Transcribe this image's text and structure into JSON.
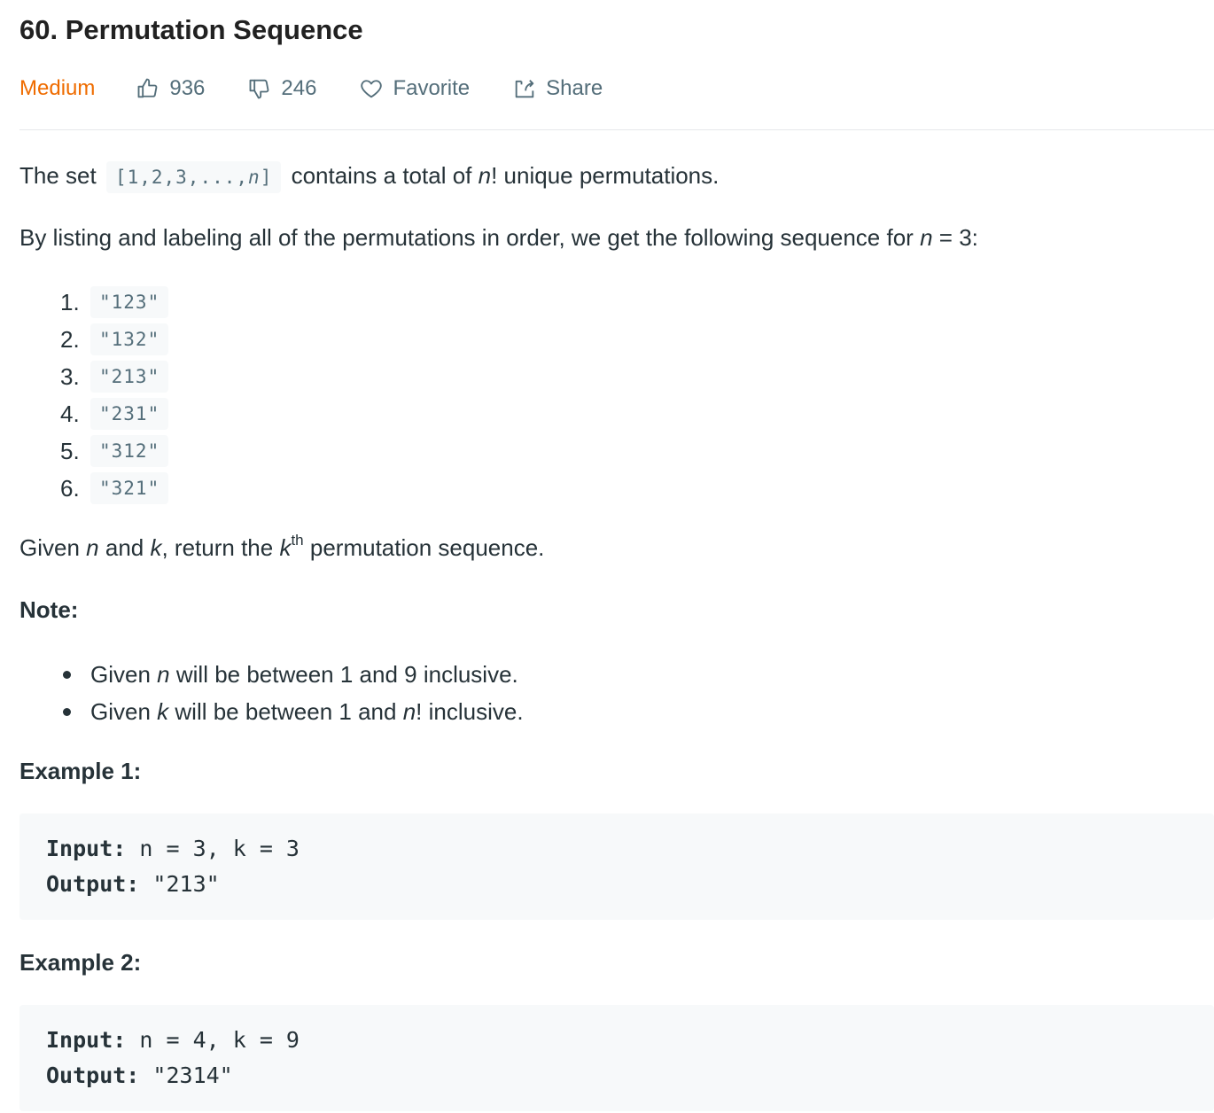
{
  "problem": {
    "title": "60. Permutation Sequence",
    "difficulty": "Medium",
    "likes": "936",
    "dislikes": "246",
    "favorite_label": "Favorite",
    "share_label": "Share"
  },
  "colors": {
    "difficulty": "#ef6c00",
    "meta_text": "#546e7a",
    "code_bg": "#f7f9fa"
  },
  "description": {
    "p1_prefix": "The set",
    "p1_code": "[1,2,3,...,",
    "p1_code_var": "n",
    "p1_code_end": "]",
    "p1_mid": "contains a total of",
    "p1_var": "n",
    "p1_suffix": "! unique permutations.",
    "p2_prefix": "By listing and labeling all of the permutations in order, we get the following sequence for",
    "p2_var": "n",
    "p2_suffix": "= 3:",
    "sequence": [
      {
        "num": "1.",
        "value": "\"123\""
      },
      {
        "num": "2.",
        "value": "\"132\""
      },
      {
        "num": "3.",
        "value": "\"213\""
      },
      {
        "num": "4.",
        "value": "\"231\""
      },
      {
        "num": "5.",
        "value": "\"312\""
      },
      {
        "num": "6.",
        "value": "\"321\""
      }
    ],
    "p3_a": "Given",
    "p3_n": "n",
    "p3_b": "and",
    "p3_k": "k",
    "p3_c": ", return the",
    "p3_k2": "k",
    "p3_sup": "th",
    "p3_d": "permutation sequence."
  },
  "note": {
    "heading": "Note:",
    "item1_a": "Given",
    "item1_var": "n",
    "item1_b": "will be between 1 and 9 inclusive.",
    "item2_a": "Given",
    "item2_var": "k",
    "item2_b": "will be between 1 and",
    "item2_var2": "n",
    "item2_c": "! inclusive."
  },
  "examples": [
    {
      "heading": "Example 1:",
      "input_label": "Input:",
      "input_value": " n = 3, k = 3",
      "output_label": "Output:",
      "output_value": " \"213\""
    },
    {
      "heading": "Example 2:",
      "input_label": "Input:",
      "input_value": " n = 4, k = 9",
      "output_label": "Output:",
      "output_value": " \"2314\""
    }
  ]
}
